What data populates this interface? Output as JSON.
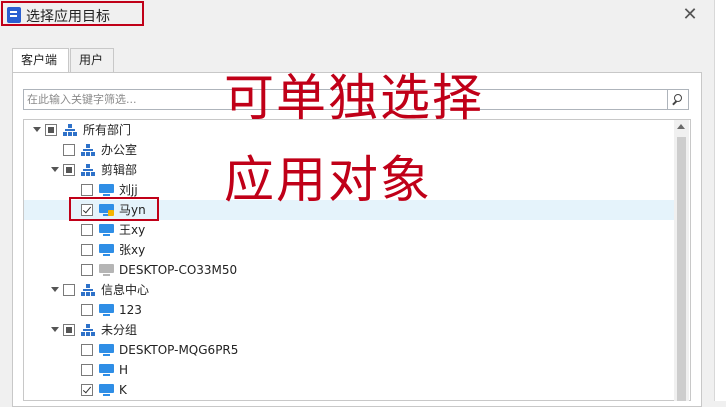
{
  "window": {
    "title": "选择应用目标",
    "close_glyph": "✕"
  },
  "tabs": [
    {
      "label": "客户端",
      "active": true
    },
    {
      "label": "用户",
      "active": false
    }
  ],
  "search": {
    "placeholder": "在此输入关键字筛选...",
    "value": ""
  },
  "tree": [
    {
      "label": "所有部门",
      "type": "org",
      "level": 0,
      "expanded": true,
      "check": "partial"
    },
    {
      "label": "办公室",
      "type": "org",
      "level": 1,
      "expanded": null,
      "check": "unchecked"
    },
    {
      "label": "剪辑部",
      "type": "org",
      "level": 1,
      "expanded": true,
      "check": "partial"
    },
    {
      "label": "刘jj",
      "type": "pc",
      "level": 2,
      "check": "unchecked"
    },
    {
      "label": "马yn",
      "type": "pc-badge",
      "level": 2,
      "check": "checked",
      "selected": true
    },
    {
      "label": "王xy",
      "type": "pc",
      "level": 2,
      "check": "unchecked"
    },
    {
      "label": "张xy",
      "type": "pc",
      "level": 2,
      "check": "unchecked"
    },
    {
      "label": "DESKTOP-CO33M50",
      "type": "pc-gray",
      "level": 2,
      "check": "unchecked"
    },
    {
      "label": "信息中心",
      "type": "org",
      "level": 1,
      "expanded": true,
      "check": "unchecked"
    },
    {
      "label": "123",
      "type": "pc",
      "level": 2,
      "check": "unchecked"
    },
    {
      "label": "未分组",
      "type": "org",
      "level": 1,
      "expanded": true,
      "check": "partial"
    },
    {
      "label": "DESKTOP-MQG6PR5",
      "type": "pc",
      "level": 2,
      "check": "unchecked"
    },
    {
      "label": "H",
      "type": "pc",
      "level": 2,
      "check": "unchecked"
    },
    {
      "label": "K",
      "type": "pc",
      "level": 2,
      "check": "checked"
    }
  ],
  "annotation": {
    "line1": "可单独选择",
    "line2": "应用对象",
    "color": "#c00018"
  }
}
